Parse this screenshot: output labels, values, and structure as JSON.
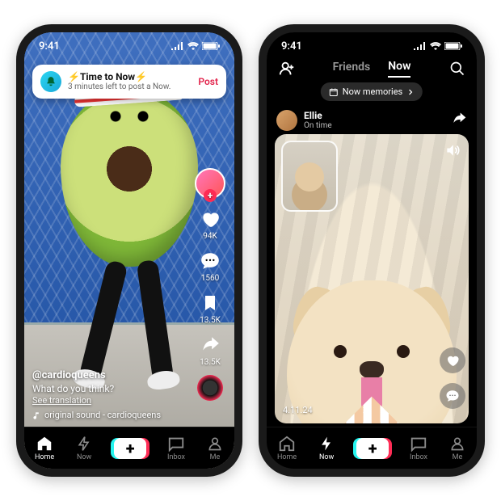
{
  "status": {
    "time": "9:41"
  },
  "banner": {
    "title": "⚡Time to Now⚡",
    "subtitle": "3 minutes left to post a Now.",
    "action": "Post"
  },
  "feed": {
    "username": "@cardioqueens",
    "caption": "What do you think?",
    "translate": "See translation",
    "sound": "original sound - cardioqueens"
  },
  "rail": {
    "likes": "94K",
    "comments": "1560",
    "saves": "13.5K",
    "shares": "13.5K"
  },
  "nav": {
    "home": "Home",
    "now": "Now",
    "inbox": "Inbox",
    "me": "Me"
  },
  "now": {
    "tab_friends": "Friends",
    "tab_now": "Now",
    "chip": "Now memories",
    "user": "Ellie",
    "status": "On time",
    "timestamp": "4.11.24"
  }
}
